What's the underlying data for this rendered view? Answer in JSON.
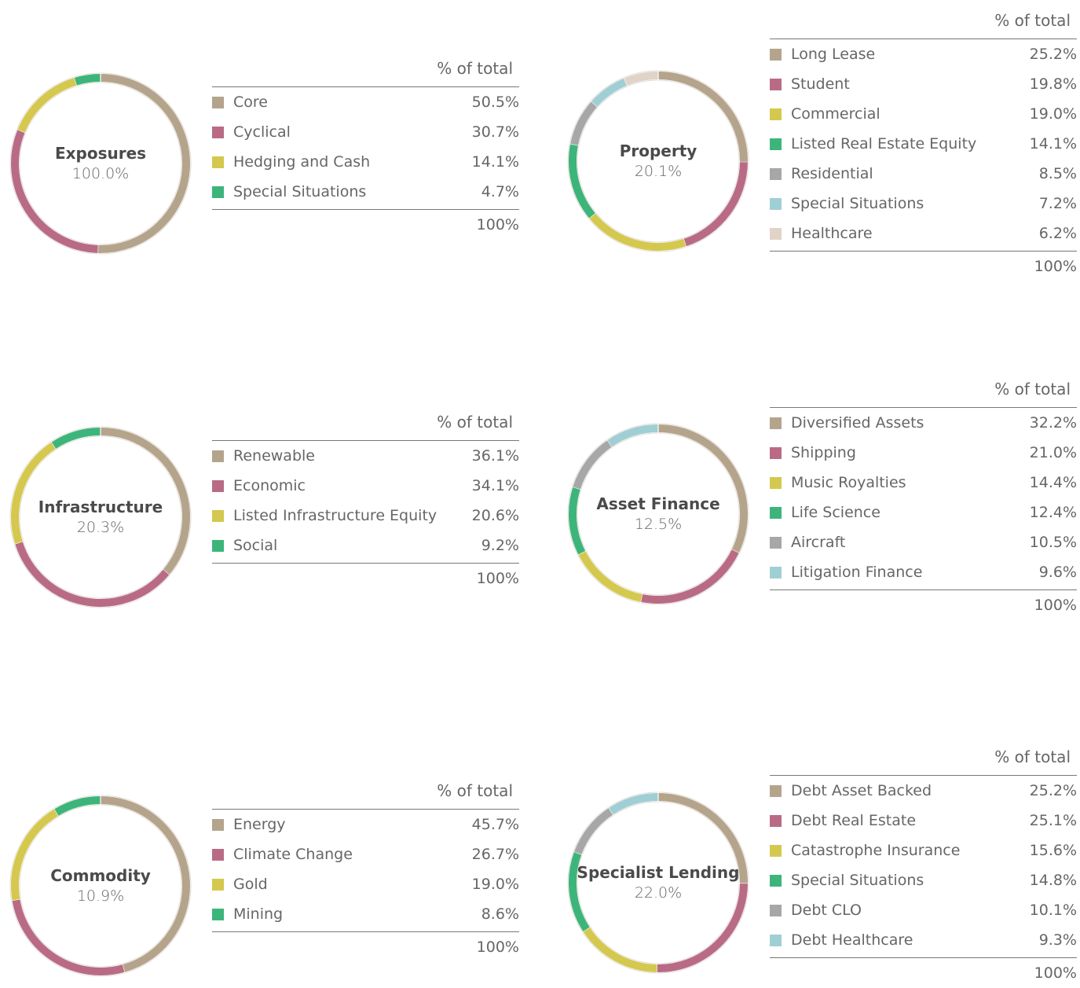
{
  "chart_data": [
    {
      "type": "pie",
      "title": "Exposures",
      "center_value": "100.0%",
      "column_header": "% of total",
      "categories": [
        "Core",
        "Cyclical",
        "Hedging and Cash",
        "Special Situations"
      ],
      "values": [
        50.5,
        30.7,
        14.1,
        4.7
      ],
      "value_labels": [
        "50.5%",
        "30.7%",
        "14.1%",
        "4.7%"
      ],
      "total_label": "100%"
    },
    {
      "type": "pie",
      "title": "Property",
      "center_value": "20.1%",
      "column_header": "% of total",
      "categories": [
        "Long Lease",
        "Student",
        "Commercial",
        "Listed Real Estate Equity",
        "Residential",
        "Special Situations",
        "Healthcare"
      ],
      "values": [
        25.2,
        19.8,
        19.0,
        14.1,
        8.5,
        7.2,
        6.2
      ],
      "value_labels": [
        "25.2%",
        "19.8%",
        "19.0%",
        "14.1%",
        "8.5%",
        "7.2%",
        "6.2%"
      ],
      "total_label": "100%"
    },
    {
      "type": "pie",
      "title": "Infrastructure",
      "center_value": "20.3%",
      "column_header": "% of total",
      "categories": [
        "Renewable",
        "Economic",
        "Listed Infrastructure Equity",
        "Social"
      ],
      "values": [
        36.1,
        34.1,
        20.6,
        9.2
      ],
      "value_labels": [
        "36.1%",
        "34.1%",
        "20.6%",
        "9.2%"
      ],
      "total_label": "100%"
    },
    {
      "type": "pie",
      "title": "Asset Finance",
      "center_value": "12.5%",
      "column_header": "% of total",
      "categories": [
        "Diversified Assets",
        "Shipping",
        "Music Royalties",
        "Life Science",
        "Aircraft",
        "Litigation Finance"
      ],
      "values": [
        32.2,
        21.0,
        14.4,
        12.4,
        10.5,
        9.6
      ],
      "value_labels": [
        "32.2%",
        "21.0%",
        "14.4%",
        "12.4%",
        "10.5%",
        "9.6%"
      ],
      "total_label": "100%"
    },
    {
      "type": "pie",
      "title": "Commodity",
      "center_value": "10.9%",
      "column_header": "% of total",
      "categories": [
        "Energy",
        "Climate Change",
        "Gold",
        "Mining"
      ],
      "values": [
        45.7,
        26.7,
        19.0,
        8.6
      ],
      "value_labels": [
        "45.7%",
        "26.7%",
        "19.0%",
        "8.6%"
      ],
      "total_label": "100%"
    },
    {
      "type": "pie",
      "title": "Specialist Lending",
      "center_value": "22.0%",
      "column_header": "% of total",
      "categories": [
        "Debt Asset Backed",
        "Debt Real Estate",
        "Catastrophe Insurance",
        "Special Situations",
        "Debt CLO",
        "Debt Healthcare"
      ],
      "values": [
        25.2,
        25.1,
        15.6,
        14.8,
        10.1,
        9.3
      ],
      "value_labels": [
        "25.2%",
        "25.1%",
        "15.6%",
        "14.8%",
        "10.1%",
        "9.3%"
      ],
      "total_label": "100%"
    }
  ],
  "palette": [
    "#b5a48c",
    "#b96b86",
    "#d4c84e",
    "#3db57a",
    "#a7a7a7",
    "#9fcfd4",
    "#e0d3c8"
  ]
}
